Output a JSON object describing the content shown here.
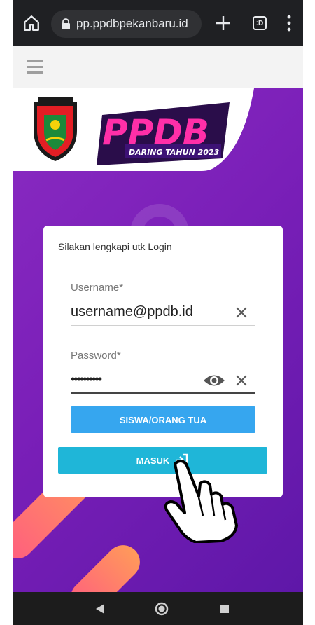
{
  "browser": {
    "url": "pp.ppdbpekanbaru.id",
    "tabs_label": ":D"
  },
  "logo": {
    "title": "PPDB",
    "subtitle": "DARING TAHUN 2023"
  },
  "login": {
    "heading": "Silakan lengkapi utk Login",
    "username_label": "Username*",
    "username_value": "username@ppdb.id",
    "password_label": "Password*",
    "password_value": "••••••••••",
    "siswa_button": "SISWA/ORANG TUA",
    "masuk_button": "MASUK"
  },
  "colors": {
    "purple": "#7a1fb8",
    "siswa_button": "#36a6ef",
    "masuk_button": "#1fb6d8",
    "logo_pink": "#ff2fa8"
  }
}
